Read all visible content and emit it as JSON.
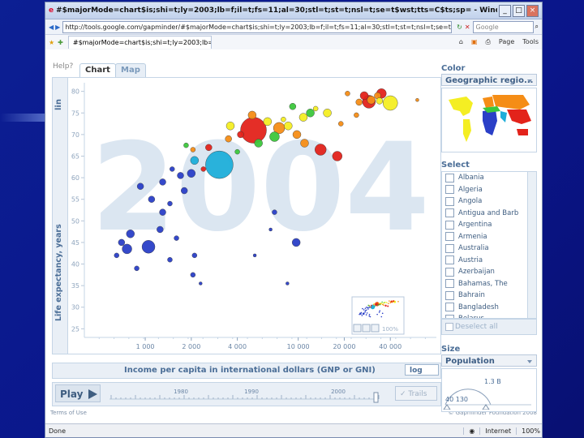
{
  "browser": {
    "title": "#$majorMode=chart$is;shi=t;ly=2003;lb=f;il=t;fs=11;al=30;stl=t;st=t;nsl=t;se=t$wst;tts=C$ts;sp= - Windows Internet Explorer",
    "address": "http://tools.google.com/gapminder/#$majorMode=chart$is;shi=t;ly=2003;lb=f;il=t;fs=11;al=30;stl=t;st=t;nsl=t;se=t",
    "search_placeholder": "Google",
    "tab_label": "#$majorMode=chart$is;shi=t;ly=2003;lb=f;il=t;fs=1...",
    "menu_page": "Page",
    "menu_tools": "Tools",
    "status_left": "Done",
    "status_zone": "Internet",
    "status_zoom": "100%"
  },
  "app": {
    "help": "Help?",
    "tabs": [
      {
        "label": "Chart"
      },
      {
        "label": "Map"
      }
    ],
    "y_scale": "lin",
    "y_label": "Life expectancy, years",
    "x_label": "Income per capita in international dollars (GNP or GNI)",
    "x_scale": "log",
    "play_label": "Play",
    "trails_label": "Trails",
    "timeline_ticks": [
      "1980",
      "1990",
      "2000"
    ],
    "footer_left": "Terms of Use",
    "footer_right": "© Gapminder Foundation 2008",
    "color_title": "Color",
    "color_value": "Geographic regio...",
    "select_title": "Select",
    "countries": [
      "Albania",
      "Algeria",
      "Angola",
      "Antigua and Barb",
      "Argentina",
      "Armenia",
      "Australia",
      "Austria",
      "Azerbaijan",
      "Bahamas, The",
      "Bahrain",
      "Bangladesh",
      "Belarus"
    ],
    "deselect_label": "Deselect all",
    "size_title": "Size",
    "size_value": "Population",
    "size_max_label": "1.3 B",
    "size_min_label": "40 130",
    "minimap_zoom": "100%"
  },
  "colors": {
    "accent": "#4b6e97",
    "panel": "#e9eff6",
    "bg": "#0c1f93"
  },
  "chart_data": {
    "type": "scatter",
    "year_watermark": "2004",
    "xlabel": "Income per capita in international dollars (GNP or GNI)",
    "ylabel": "Life expectancy, years",
    "x_scale": "log",
    "x_ticks": [
      1000,
      2000,
      4000,
      10000,
      20000,
      40000
    ],
    "x_tick_labels": [
      "1 000",
      "2 000",
      "4 000",
      "10 000",
      "20 000",
      "40 000"
    ],
    "ylim": [
      23,
      82
    ],
    "y_ticks": [
      25,
      30,
      35,
      40,
      45,
      50,
      55,
      60,
      65,
      70,
      75,
      80
    ],
    "regions": {
      "Sub-Saharan Africa": "#2a3fc7",
      "South Asia": "#1eaed9",
      "East Asia & Pacific": "#e3231b",
      "Europe & Central Asia": "#f58d16",
      "Middle East & North Africa": "#3cc73c",
      "America": "#f4ee23"
    },
    "points": [
      {
        "x": 5100,
        "y": 71,
        "size": 16,
        "region": "East Asia & Pacific"
      },
      {
        "x": 3050,
        "y": 63,
        "size": 17,
        "region": "South Asia"
      },
      {
        "x": 2100,
        "y": 64,
        "size": 5,
        "region": "South Asia"
      },
      {
        "x": 7500,
        "y": 71.5,
        "size": 7,
        "region": "Europe & Central Asia"
      },
      {
        "x": 9800,
        "y": 70,
        "size": 5,
        "region": "Europe & Central Asia"
      },
      {
        "x": 8600,
        "y": 72,
        "size": 5,
        "region": "America"
      },
      {
        "x": 14000,
        "y": 66.5,
        "size": 7,
        "region": "East Asia & Pacific"
      },
      {
        "x": 18000,
        "y": 65,
        "size": 6,
        "region": "East Asia & Pacific"
      },
      {
        "x": 12000,
        "y": 75,
        "size": 5,
        "region": "Middle East & North Africa"
      },
      {
        "x": 40000,
        "y": 77.3,
        "size": 9,
        "region": "America"
      },
      {
        "x": 29000,
        "y": 77.6,
        "size": 8,
        "region": "East Asia & Pacific"
      },
      {
        "x": 33000,
        "y": 79,
        "size": 4,
        "region": "Europe & Central Asia"
      },
      {
        "x": 25000,
        "y": 77.5,
        "size": 4,
        "region": "Europe & Central Asia"
      },
      {
        "x": 30000,
        "y": 78,
        "size": 5,
        "region": "Europe & Central Asia"
      },
      {
        "x": 34000,
        "y": 77.8,
        "size": 4,
        "region": "America"
      },
      {
        "x": 15500,
        "y": 75,
        "size": 5,
        "region": "America"
      },
      {
        "x": 19000,
        "y": 72.5,
        "size": 3,
        "region": "Europe & Central Asia"
      },
      {
        "x": 10800,
        "y": 74,
        "size": 5,
        "region": "America"
      },
      {
        "x": 6300,
        "y": 73,
        "size": 5,
        "region": "America"
      },
      {
        "x": 4200,
        "y": 70,
        "size": 4,
        "region": "East Asia & Pacific"
      },
      {
        "x": 3600,
        "y": 72,
        "size": 5,
        "region": "America"
      },
      {
        "x": 2600,
        "y": 67,
        "size": 4,
        "region": "East Asia & Pacific"
      },
      {
        "x": 2050,
        "y": 66.5,
        "size": 3,
        "region": "Europe & Central Asia"
      },
      {
        "x": 1850,
        "y": 67.5,
        "size": 3,
        "region": "Middle East & North Africa"
      },
      {
        "x": 1500,
        "y": 62,
        "size": 3,
        "region": "Sub-Saharan Africa"
      },
      {
        "x": 1300,
        "y": 59,
        "size": 4,
        "region": "Sub-Saharan Africa"
      },
      {
        "x": 1450,
        "y": 54,
        "size": 3,
        "region": "Sub-Saharan Africa"
      },
      {
        "x": 1100,
        "y": 55,
        "size": 4,
        "region": "Sub-Saharan Africa"
      },
      {
        "x": 1800,
        "y": 57,
        "size": 4,
        "region": "Sub-Saharan Africa"
      },
      {
        "x": 2400,
        "y": 62,
        "size": 3,
        "region": "East Asia & Pacific"
      },
      {
        "x": 7000,
        "y": 52,
        "size": 3,
        "region": "Sub-Saharan Africa"
      },
      {
        "x": 9700,
        "y": 45,
        "size": 5,
        "region": "Sub-Saharan Africa"
      },
      {
        "x": 800,
        "y": 47,
        "size": 5,
        "region": "Sub-Saharan Africa"
      },
      {
        "x": 700,
        "y": 45,
        "size": 4,
        "region": "Sub-Saharan Africa"
      },
      {
        "x": 760,
        "y": 43.5,
        "size": 6,
        "region": "Sub-Saharan Africa"
      },
      {
        "x": 1050,
        "y": 44,
        "size": 8,
        "region": "Sub-Saharan Africa"
      },
      {
        "x": 1250,
        "y": 48,
        "size": 4,
        "region": "Sub-Saharan Africa"
      },
      {
        "x": 1600,
        "y": 46,
        "size": 3,
        "region": "Sub-Saharan Africa"
      },
      {
        "x": 2100,
        "y": 42,
        "size": 3,
        "region": "Sub-Saharan Africa"
      },
      {
        "x": 650,
        "y": 42,
        "size": 3,
        "region": "Sub-Saharan Africa"
      },
      {
        "x": 880,
        "y": 39,
        "size": 3,
        "region": "Sub-Saharan Africa"
      },
      {
        "x": 1450,
        "y": 41,
        "size": 3,
        "region": "Sub-Saharan Africa"
      },
      {
        "x": 2050,
        "y": 37.5,
        "size": 3,
        "region": "Sub-Saharan Africa"
      },
      {
        "x": 2300,
        "y": 35.5,
        "size": 2,
        "region": "Sub-Saharan Africa"
      },
      {
        "x": 8500,
        "y": 35.5,
        "size": 2,
        "region": "Sub-Saharan Africa"
      },
      {
        "x": 5200,
        "y": 42,
        "size": 2,
        "region": "Sub-Saharan Africa"
      },
      {
        "x": 6600,
        "y": 48,
        "size": 2,
        "region": "Sub-Saharan Africa"
      },
      {
        "x": 1300,
        "y": 52,
        "size": 4,
        "region": "Sub-Saharan Africa"
      },
      {
        "x": 930,
        "y": 58,
        "size": 4,
        "region": "Sub-Saharan Africa"
      },
      {
        "x": 1700,
        "y": 60.5,
        "size": 4,
        "region": "Sub-Saharan Africa"
      },
      {
        "x": 2000,
        "y": 61,
        "size": 5,
        "region": "Sub-Saharan Africa"
      },
      {
        "x": 4000,
        "y": 66,
        "size": 3,
        "region": "Middle East & North Africa"
      },
      {
        "x": 5500,
        "y": 68,
        "size": 5,
        "region": "Middle East & North Africa"
      },
      {
        "x": 7000,
        "y": 69.5,
        "size": 6,
        "region": "Middle East & North Africa"
      },
      {
        "x": 5000,
        "y": 74.5,
        "size": 5,
        "region": "Europe & Central Asia"
      },
      {
        "x": 3500,
        "y": 69,
        "size": 4,
        "region": "Europe & Central Asia"
      },
      {
        "x": 11000,
        "y": 68,
        "size": 5,
        "region": "Europe & Central Asia"
      },
      {
        "x": 27000,
        "y": 79,
        "size": 5,
        "region": "East Asia & Pacific"
      },
      {
        "x": 21000,
        "y": 79.5,
        "size": 3,
        "region": "Europe & Central Asia"
      },
      {
        "x": 35000,
        "y": 79.5,
        "size": 6,
        "region": "East Asia & Pacific"
      },
      {
        "x": 24000,
        "y": 74.5,
        "size": 3,
        "region": "Europe & Central Asia"
      },
      {
        "x": 13000,
        "y": 76,
        "size": 3,
        "region": "America"
      },
      {
        "x": 8000,
        "y": 73.5,
        "size": 3,
        "region": "America"
      },
      {
        "x": 9200,
        "y": 76.5,
        "size": 4,
        "region": "Middle East & North Africa"
      },
      {
        "x": 60000,
        "y": 78,
        "size": 2,
        "region": "Europe & Central Asia"
      }
    ]
  }
}
